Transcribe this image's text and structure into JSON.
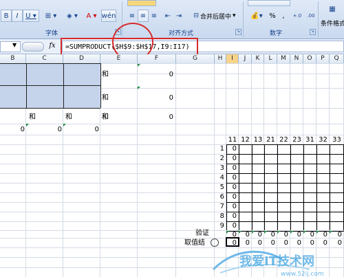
{
  "ribbon": {
    "group_font_label": "字体",
    "group_align_label": "对齐方式",
    "group_number_label": "数字",
    "merge_center_label": "合并后居中",
    "number_format_symbols": [
      "%",
      ","
    ],
    "decimal_increase": "+.0 .00",
    "decimal_decrease": ".00 →.0",
    "conditional_format_label": "条件格式",
    "wrap_text_symbol": "wén"
  },
  "formula_bar": {
    "fx": "fx",
    "formula": "=SUMPRODUCT($H$9:$H$17,I9:I17)"
  },
  "columns": [
    "B",
    "C",
    "D",
    "E",
    "F",
    "G",
    "H",
    "I",
    "J",
    "K",
    "L",
    "M",
    "N",
    "O",
    "P",
    "Q"
  ],
  "sheet": {
    "he_label": "和",
    "zero": "0",
    "header_numbers": [
      "11",
      "12",
      "13",
      "21",
      "22",
      "23",
      "31",
      "32",
      "33"
    ],
    "row_numbers": [
      "1",
      "2",
      "3",
      "4",
      "5",
      "6",
      "7",
      "8",
      "9"
    ],
    "verify_label": "验证",
    "pick_label": "取值结"
  },
  "watermark": {
    "text": "我爱IT技术网",
    "url": "www.52ij.com"
  },
  "colors": {
    "annotation_red": "#d62a2a",
    "selected_col": "#f8d48a",
    "blue_fill": "#c5d4ea"
  }
}
